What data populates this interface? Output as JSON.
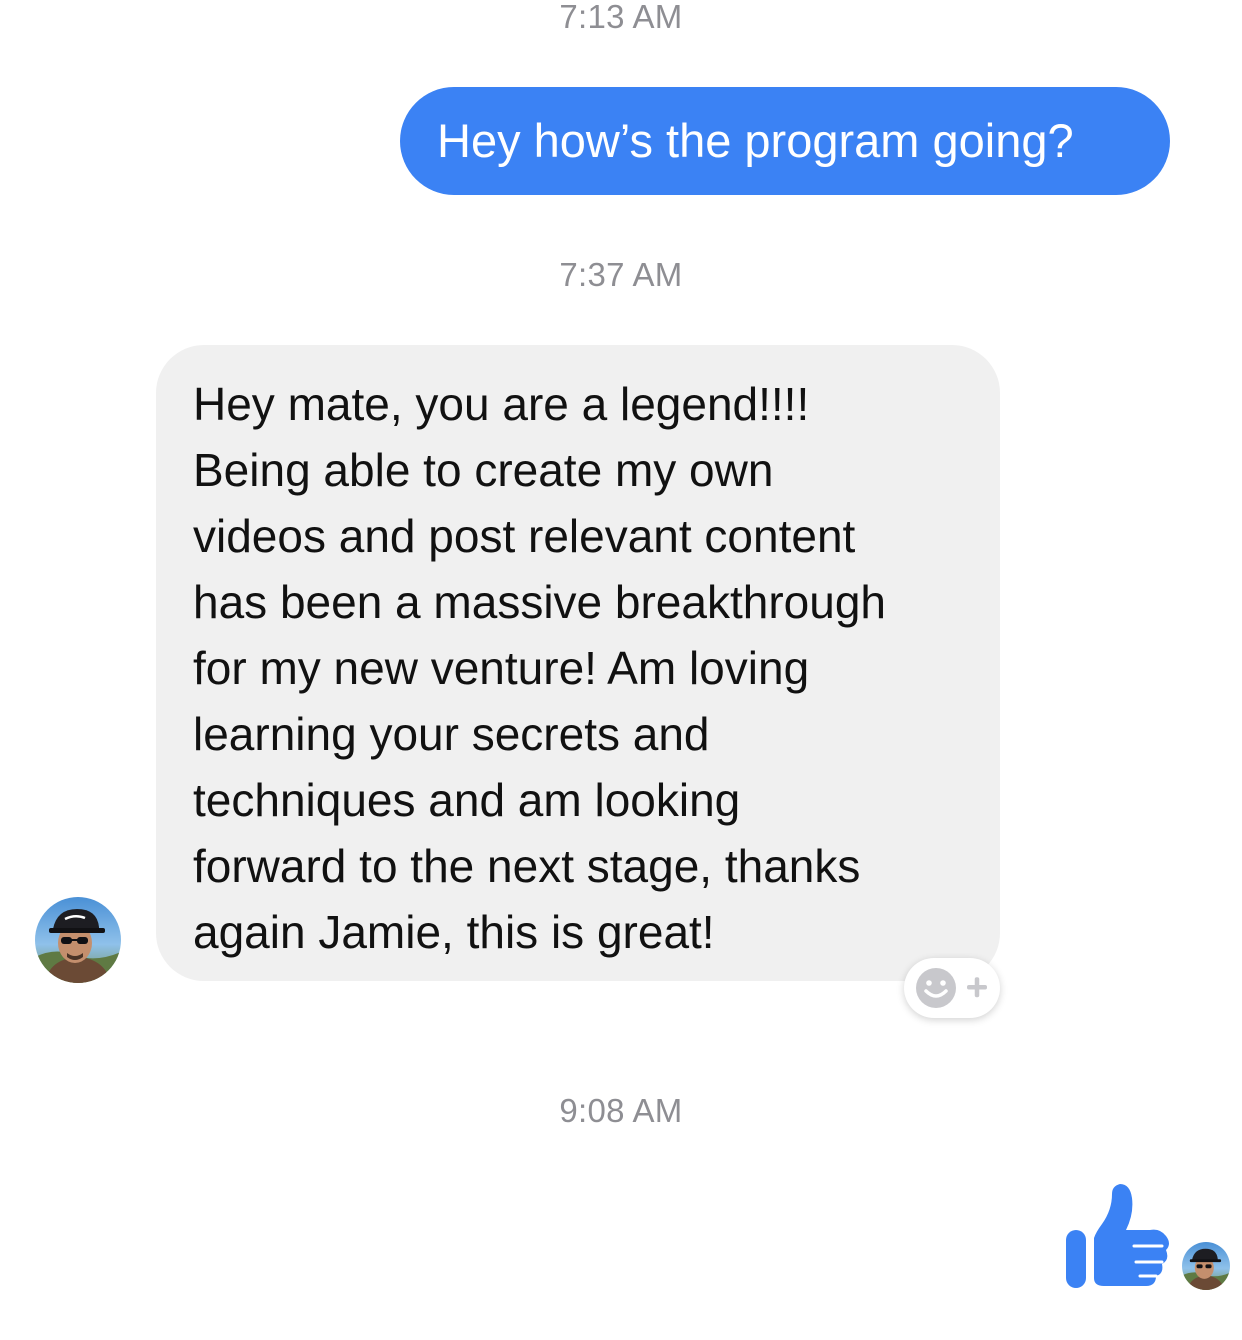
{
  "timestamps": [
    "7:13 AM",
    "7:37 AM",
    "9:08 AM"
  ],
  "messages": {
    "outgoing_1": {
      "text": "Hey how’s the program going?"
    },
    "incoming_1": {
      "lines": [
        "Hey mate, you are a legend!!!!",
        "Being able to create my own",
        "videos and post relevant content",
        "has been a massive breakthrough",
        "for my new venture! Am loving",
        "learning your secrets and",
        "techniques and am looking",
        "forward to the next stage, thanks",
        "again Jamie, this is great!"
      ]
    }
  },
  "icons": {
    "reaction": "add-reaction-smiley-plus-icon",
    "like": "thumbs-up-icon",
    "avatar": "contact-avatar"
  },
  "colors": {
    "accent": "#3b82f4",
    "incoming_bubble": "#f0f0f0",
    "timestamp": "#8e8e93",
    "reaction_icon": "#c8c8cc"
  }
}
